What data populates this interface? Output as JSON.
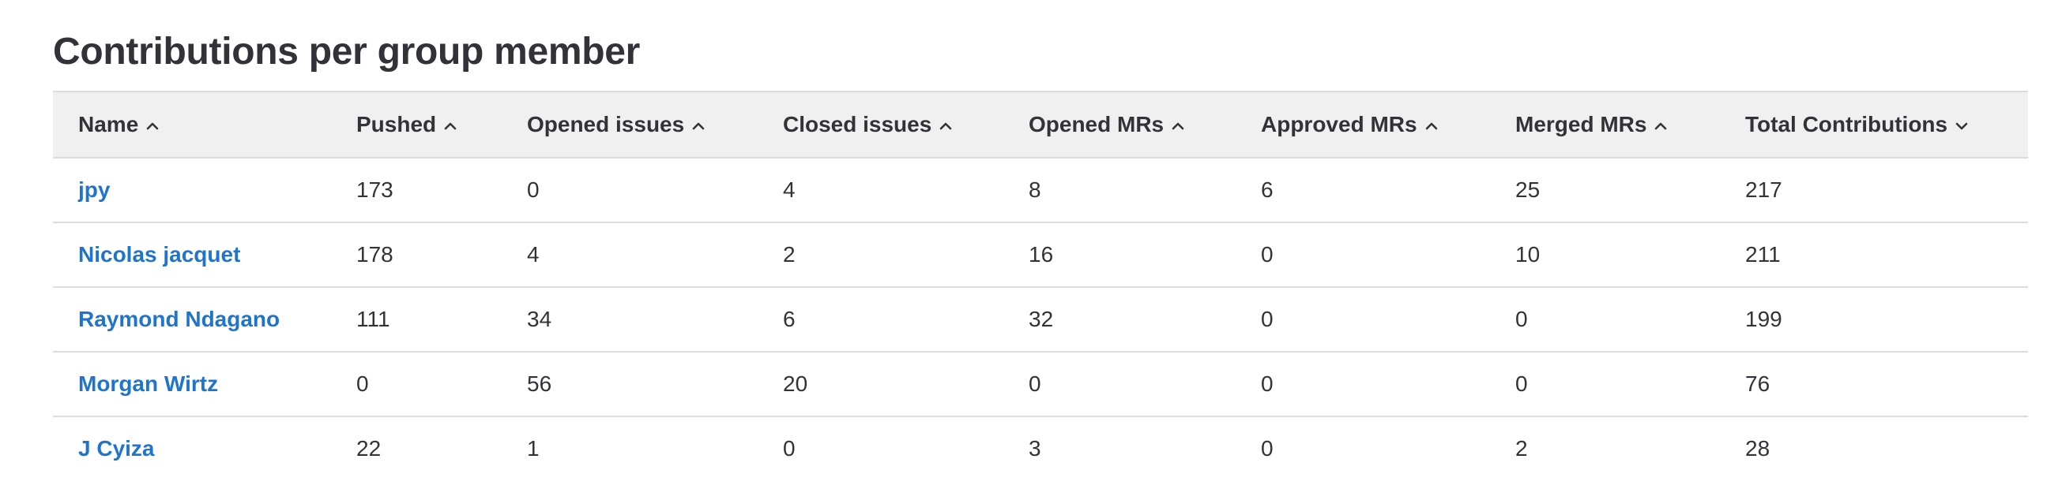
{
  "page": {
    "title": "Contributions per group member"
  },
  "table": {
    "columns": [
      {
        "label": "Name",
        "sort_icon": "chevron-up-icon"
      },
      {
        "label": "Pushed",
        "sort_icon": "chevron-up-icon"
      },
      {
        "label": "Opened issues",
        "sort_icon": "chevron-up-icon"
      },
      {
        "label": "Closed issues",
        "sort_icon": "chevron-up-icon"
      },
      {
        "label": "Opened MRs",
        "sort_icon": "chevron-up-icon"
      },
      {
        "label": "Approved MRs",
        "sort_icon": "chevron-up-icon"
      },
      {
        "label": "Merged MRs",
        "sort_icon": "chevron-up-icon"
      },
      {
        "label": "Total Contributions",
        "sort_icon": "chevron-down-icon"
      }
    ],
    "rows": [
      {
        "name": "jpy",
        "pushed": "173",
        "opened_issues": "0",
        "closed_issues": "4",
        "opened_mrs": "8",
        "approved_mrs": "6",
        "merged_mrs": "25",
        "total": "217"
      },
      {
        "name": "Nicolas jacquet",
        "pushed": "178",
        "opened_issues": "4",
        "closed_issues": "2",
        "opened_mrs": "16",
        "approved_mrs": "0",
        "merged_mrs": "10",
        "total": "211"
      },
      {
        "name": "Raymond Ndagano",
        "pushed": "111",
        "opened_issues": "34",
        "closed_issues": "6",
        "opened_mrs": "32",
        "approved_mrs": "0",
        "merged_mrs": "0",
        "total": "199"
      },
      {
        "name": "Morgan Wirtz",
        "pushed": "0",
        "opened_issues": "56",
        "closed_issues": "20",
        "opened_mrs": "0",
        "approved_mrs": "0",
        "merged_mrs": "0",
        "total": "76"
      },
      {
        "name": "J Cyiza",
        "pushed": "22",
        "opened_issues": "1",
        "closed_issues": "0",
        "opened_mrs": "3",
        "approved_mrs": "0",
        "merged_mrs": "2",
        "total": "28"
      }
    ]
  },
  "colors": {
    "text": "#333238",
    "link": "#1f75cb",
    "header_bg": "#f0f0f0",
    "border": "#dcdcde"
  }
}
